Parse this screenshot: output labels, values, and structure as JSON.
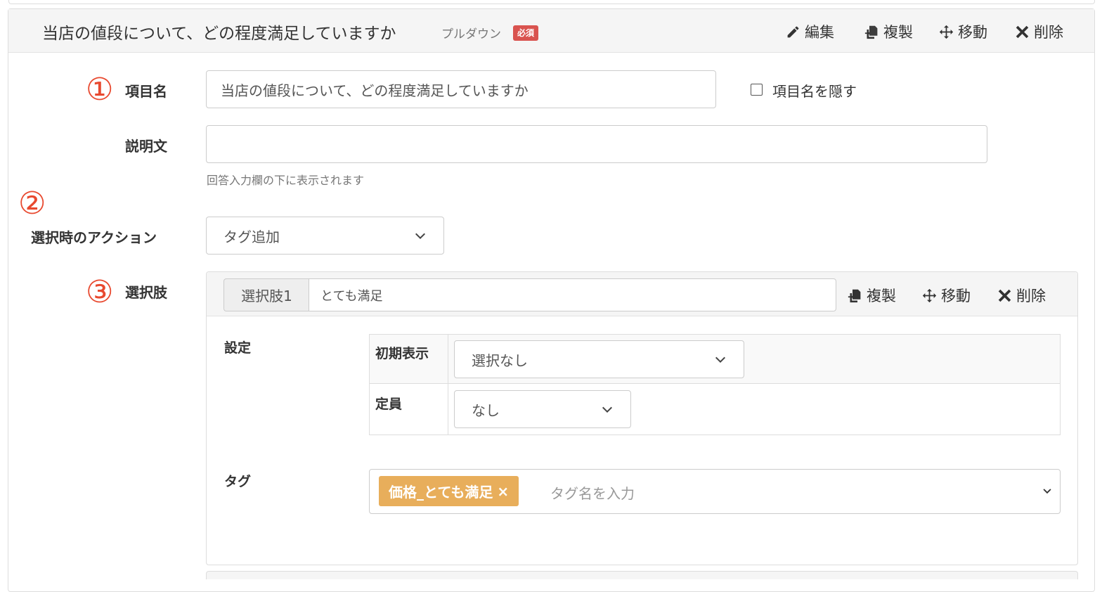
{
  "question": {
    "title": "当店の値段について、どの程度満足していますか",
    "type_label": "プルダウン",
    "required_badge": "必須",
    "actions": {
      "edit": "編集",
      "duplicate": "複製",
      "move": "移動",
      "delete": "削除"
    }
  },
  "form": {
    "item_name": {
      "marker": "①",
      "label": "項目名",
      "value": "当店の値段について、どの程度満足していますか",
      "hide_label": "項目名を隠す"
    },
    "description": {
      "label": "説明文",
      "value": "",
      "help": "回答入力欄の下に表示されます"
    },
    "selection_action": {
      "marker": "②",
      "label": "選択時のアクション",
      "selected": "タグ追加"
    },
    "choices": {
      "marker": "③",
      "label": "選択肢",
      "items": [
        {
          "addon": "選択肢1",
          "value": "とても満足",
          "actions": {
            "duplicate": "複製",
            "move": "移動",
            "delete": "削除"
          },
          "settings_label": "設定",
          "settings": {
            "initial_display": {
              "label": "初期表示",
              "selected": "選択なし"
            },
            "capacity": {
              "label": "定員",
              "selected": "なし"
            }
          },
          "tag_label": "タグ",
          "tags": [
            "価格_とても満足"
          ],
          "tag_remove": "×",
          "tag_placeholder": "タグ名を入力"
        }
      ]
    }
  },
  "colors": {
    "accent_marker": "#e8492f",
    "required_badge": "#d9534f",
    "tag_chip": "#e8ae5b"
  }
}
